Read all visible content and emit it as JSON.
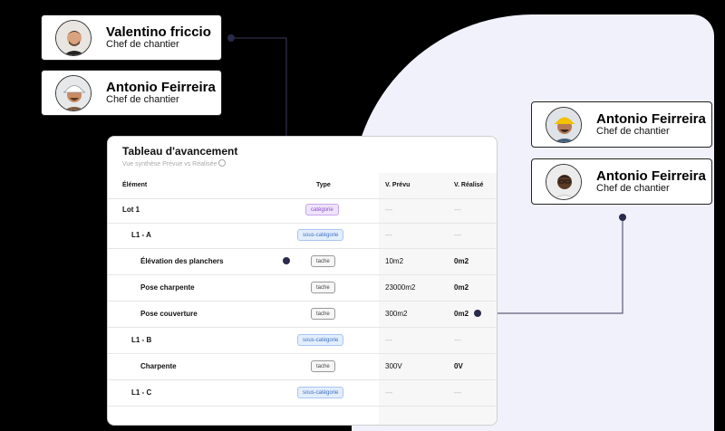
{
  "people": [
    {
      "name": "Valentino friccio",
      "role": "Chef de chantier",
      "skin": "#d9a380",
      "hair": "#3a2a20"
    },
    {
      "name": "Antonio Feirreira",
      "role": "Chef de chantier",
      "skin": "#c98b62",
      "hair": "#ffffff"
    },
    {
      "name": "Antonio Feirreira",
      "role": "Chef de chantier",
      "skin": "#b57a55",
      "hair": "#f2c200"
    },
    {
      "name": "Antonio Feirreira",
      "role": "Chef de chantier",
      "skin": "#5b3a26",
      "hair": "#1a1a1a"
    }
  ],
  "table": {
    "title": "Tableau d'avancement",
    "subtitle": "Vue synthèse Prévue vs Réalisée",
    "columns": {
      "element": "Élément",
      "type": "Type",
      "prevu": "V. Prévu",
      "realise": "V. Réalisé"
    },
    "rows": [
      {
        "element": "Lot 1",
        "type": "catégorie",
        "prevu": "—",
        "realise": "—"
      },
      {
        "element": "L1 - A",
        "type": "sous-catégorie",
        "prevu": "—",
        "realise": "—"
      },
      {
        "element": "Élévation des planchers",
        "type": "tache",
        "prevu": "10m2",
        "realise": "0m2"
      },
      {
        "element": "Pose charpente",
        "type": "tache",
        "prevu": "23000m2",
        "realise": "0m2"
      },
      {
        "element": "Pose couverture",
        "type": "tache",
        "prevu": "300m2",
        "realise": "0m2"
      },
      {
        "element": "L1 - B",
        "type": "sous-catégorie",
        "prevu": "—",
        "realise": "—"
      },
      {
        "element": "Charpente",
        "type": "tache",
        "prevu": "300V",
        "realise": "0V"
      },
      {
        "element": "L1 - C",
        "type": "sous-catégorie",
        "prevu": "—",
        "realise": "—"
      }
    ]
  },
  "colors": {
    "panel": "#f1f1fb",
    "connector": "#3a3a5a",
    "dot": "#2a2a4a"
  }
}
